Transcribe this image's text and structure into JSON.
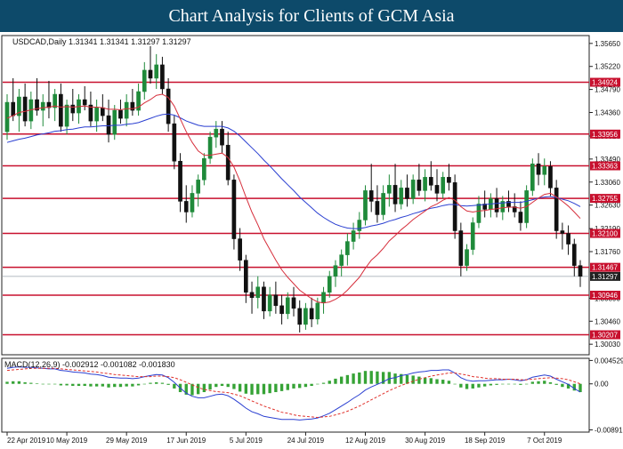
{
  "banner": {
    "title": "Chart Analysis for Clients of GCM Asia"
  },
  "colors": {
    "up": "#1f8a3a",
    "down": "#111111",
    "level_line": "#c8102e",
    "ma_red": "#d62f3c",
    "ma_blue": "#2a3fd1",
    "macd_line": "#2a3fd1",
    "signal_line": "#e0312b",
    "hist": "#36a336",
    "price_tag": "#222222"
  },
  "chart_data": [
    {
      "type": "candlestick",
      "symbol_label": "USDCAD,Daily  1.31341 1.31341 1.31297 1.31297",
      "ylim": [
        1.2985,
        1.3578
      ],
      "x_ticks": [
        "22 Apr 2019",
        "10 May 2019",
        "29 May 2019",
        "17 Jun 2019",
        "5 Jul 2019",
        "24 Jul 2019",
        "12 Aug 2019",
        "30 Aug 2019",
        "18 Sep 2019",
        "7 Oct 2019"
      ],
      "y_ticks": [
        1.3565,
        1.3522,
        1.3479,
        1.3436,
        1.3392,
        1.3349,
        1.3306,
        1.3263,
        1.3219,
        1.3176,
        1.3089,
        1.3046,
        1.3003
      ],
      "levels": [
        1.34924,
        1.33956,
        1.33363,
        1.32755,
        1.321,
        1.31467,
        1.30946,
        1.30207
      ],
      "level_labels": [
        "1.34924",
        "1.33956",
        "1.33363",
        "1.32755",
        "1.32100",
        "1.31467",
        "1.30946",
        "1.30207"
      ],
      "current_price": 1.31297,
      "current_price_label": "1.31297",
      "ohlc": [
        [
          1.34,
          1.347,
          1.3385,
          1.3455
        ],
        [
          1.3455,
          1.35,
          1.342,
          1.343
        ],
        [
          1.343,
          1.348,
          1.34,
          1.3465
        ],
        [
          1.3465,
          1.349,
          1.341,
          1.342
        ],
        [
          1.342,
          1.3475,
          1.3405,
          1.346
        ],
        [
          1.346,
          1.35,
          1.343,
          1.344
        ],
        [
          1.344,
          1.347,
          1.341,
          1.3455
        ],
        [
          1.3455,
          1.3495,
          1.3425,
          1.3445
        ],
        [
          1.3445,
          1.348,
          1.342,
          1.347
        ],
        [
          1.347,
          1.349,
          1.34,
          1.341
        ],
        [
          1.341,
          1.346,
          1.3395,
          1.345
        ],
        [
          1.345,
          1.348,
          1.342,
          1.3435
        ],
        [
          1.3435,
          1.347,
          1.3415,
          1.346
        ],
        [
          1.346,
          1.3485,
          1.344,
          1.345
        ],
        [
          1.345,
          1.3475,
          1.341,
          1.342
        ],
        [
          1.342,
          1.346,
          1.34,
          1.3445
        ],
        [
          1.3445,
          1.347,
          1.342,
          1.343
        ],
        [
          1.343,
          1.346,
          1.338,
          1.3395
        ],
        [
          1.3395,
          1.345,
          1.3385,
          1.344
        ],
        [
          1.344,
          1.346,
          1.3415,
          1.3425
        ],
        [
          1.3425,
          1.347,
          1.341,
          1.3455
        ],
        [
          1.3455,
          1.348,
          1.343,
          1.344
        ],
        [
          1.344,
          1.349,
          1.343,
          1.3475
        ],
        [
          1.3475,
          1.353,
          1.346,
          1.3515
        ],
        [
          1.3515,
          1.356,
          1.349,
          1.35
        ],
        [
          1.35,
          1.3545,
          1.348,
          1.3525
        ],
        [
          1.3525,
          1.354,
          1.347,
          1.348
        ],
        [
          1.348,
          1.35,
          1.34,
          1.3415
        ],
        [
          1.3415,
          1.343,
          1.333,
          1.3345
        ],
        [
          1.3345,
          1.336,
          1.325,
          1.327
        ],
        [
          1.327,
          1.33,
          1.323,
          1.325
        ],
        [
          1.325,
          1.33,
          1.324,
          1.3285
        ],
        [
          1.3285,
          1.332,
          1.326,
          1.331
        ],
        [
          1.331,
          1.336,
          1.33,
          1.335
        ],
        [
          1.335,
          1.34,
          1.334,
          1.339
        ],
        [
          1.339,
          1.342,
          1.337,
          1.3405
        ],
        [
          1.3405,
          1.342,
          1.336,
          1.3375
        ],
        [
          1.3375,
          1.34,
          1.33,
          1.331
        ],
        [
          1.331,
          1.332,
          1.318,
          1.32
        ],
        [
          1.32,
          1.322,
          1.314,
          1.316
        ],
        [
          1.316,
          1.317,
          1.308,
          1.31
        ],
        [
          1.31,
          1.312,
          1.306,
          1.309
        ],
        [
          1.309,
          1.313,
          1.307,
          1.311
        ],
        [
          1.311,
          1.312,
          1.305,
          1.3065
        ],
        [
          1.3065,
          1.311,
          1.3055,
          1.3095
        ],
        [
          1.3095,
          1.312,
          1.306,
          1.3075
        ],
        [
          1.3075,
          1.3095,
          1.304,
          1.306
        ],
        [
          1.306,
          1.31,
          1.305,
          1.309
        ],
        [
          1.309,
          1.311,
          1.3055,
          1.307
        ],
        [
          1.307,
          1.3085,
          1.3025,
          1.304
        ],
        [
          1.304,
          1.308,
          1.303,
          1.307
        ],
        [
          1.307,
          1.309,
          1.3035,
          1.305
        ],
        [
          1.305,
          1.309,
          1.304,
          1.308
        ],
        [
          1.308,
          1.311,
          1.306,
          1.31
        ],
        [
          1.31,
          1.314,
          1.309,
          1.313
        ],
        [
          1.313,
          1.316,
          1.311,
          1.315
        ],
        [
          1.315,
          1.318,
          1.313,
          1.317
        ],
        [
          1.317,
          1.321,
          1.315,
          1.3195
        ],
        [
          1.3195,
          1.323,
          1.318,
          1.3215
        ],
        [
          1.3215,
          1.325,
          1.32,
          1.3235
        ],
        [
          1.3235,
          1.33,
          1.3225,
          1.329
        ],
        [
          1.329,
          1.334,
          1.325,
          1.327
        ],
        [
          1.327,
          1.33,
          1.323,
          1.3245
        ],
        [
          1.3245,
          1.33,
          1.3235,
          1.3285
        ],
        [
          1.3285,
          1.332,
          1.326,
          1.33
        ],
        [
          1.33,
          1.334,
          1.325,
          1.3265
        ],
        [
          1.3265,
          1.331,
          1.3255,
          1.3295
        ],
        [
          1.3295,
          1.332,
          1.326,
          1.3275
        ],
        [
          1.3275,
          1.332,
          1.3265,
          1.331
        ],
        [
          1.331,
          1.334,
          1.328,
          1.329
        ],
        [
          1.329,
          1.333,
          1.327,
          1.3315
        ],
        [
          1.3315,
          1.3345,
          1.329,
          1.33
        ],
        [
          1.33,
          1.333,
          1.327,
          1.3285
        ],
        [
          1.3285,
          1.3325,
          1.3275,
          1.3315
        ],
        [
          1.3315,
          1.334,
          1.329,
          1.3305
        ],
        [
          1.3305,
          1.332,
          1.32,
          1.3215
        ],
        [
          1.3215,
          1.323,
          1.313,
          1.315
        ],
        [
          1.315,
          1.319,
          1.314,
          1.318
        ],
        [
          1.318,
          1.324,
          1.317,
          1.323
        ],
        [
          1.323,
          1.328,
          1.322,
          1.3265
        ],
        [
          1.3265,
          1.329,
          1.324,
          1.3255
        ],
        [
          1.3255,
          1.3285,
          1.324,
          1.3275
        ],
        [
          1.3275,
          1.3295,
          1.324,
          1.325
        ],
        [
          1.325,
          1.328,
          1.3235,
          1.327
        ],
        [
          1.327,
          1.329,
          1.325,
          1.326
        ],
        [
          1.326,
          1.3285,
          1.324,
          1.325
        ],
        [
          1.325,
          1.327,
          1.3215,
          1.323
        ],
        [
          1.323,
          1.33,
          1.322,
          1.329
        ],
        [
          1.329,
          1.335,
          1.328,
          1.334
        ],
        [
          1.334,
          1.336,
          1.33,
          1.332
        ],
        [
          1.332,
          1.335,
          1.33,
          1.3335
        ],
        [
          1.3335,
          1.3345,
          1.328,
          1.3295
        ],
        [
          1.3295,
          1.331,
          1.32,
          1.3215
        ],
        [
          1.3215,
          1.323,
          1.318,
          1.321
        ],
        [
          1.321,
          1.3225,
          1.317,
          1.319
        ],
        [
          1.319,
          1.32,
          1.313,
          1.315
        ],
        [
          1.315,
          1.316,
          1.311,
          1.313
        ]
      ],
      "ma_red": [
        1.3425,
        1.343,
        1.3436,
        1.3438,
        1.3441,
        1.3443,
        1.3445,
        1.3446,
        1.3448,
        1.3446,
        1.3447,
        1.3446,
        1.3447,
        1.3448,
        1.3446,
        1.3446,
        1.3445,
        1.3442,
        1.3442,
        1.3441,
        1.3443,
        1.3443,
        1.3446,
        1.3454,
        1.346,
        1.3468,
        1.347,
        1.3464,
        1.3448,
        1.3424,
        1.34,
        1.338,
        1.3364,
        1.3356,
        1.3356,
        1.3358,
        1.336,
        1.3352,
        1.3334,
        1.3308,
        1.3278,
        1.325,
        1.3226,
        1.32,
        1.318,
        1.316,
        1.3142,
        1.3128,
        1.3116,
        1.3104,
        1.3096,
        1.3088,
        1.3082,
        1.308,
        1.3082,
        1.3087,
        1.3094,
        1.3104,
        1.3116,
        1.3128,
        1.3145,
        1.316,
        1.317,
        1.3182,
        1.3196,
        1.3206,
        1.3217,
        1.3226,
        1.3236,
        1.3244,
        1.3252,
        1.326,
        1.3265,
        1.3272,
        1.3277,
        1.3272,
        1.326,
        1.3252,
        1.325,
        1.3252,
        1.3253,
        1.3255,
        1.3256,
        1.3258,
        1.3259,
        1.3259,
        1.3257,
        1.326,
        1.3268,
        1.3276,
        1.3283,
        1.3285,
        1.3278,
        1.327,
        1.3261,
        1.325,
        1.3238
      ],
      "ma_blue": [
        1.338,
        1.3383,
        1.3386,
        1.3388,
        1.3391,
        1.3394,
        1.3396,
        1.3398,
        1.3401,
        1.3402,
        1.3404,
        1.3405,
        1.3407,
        1.3409,
        1.3409,
        1.341,
        1.3411,
        1.3411,
        1.3412,
        1.3412,
        1.3414,
        1.3415,
        1.3417,
        1.3421,
        1.3425,
        1.3429,
        1.3432,
        1.3433,
        1.3431,
        1.3426,
        1.342,
        1.3416,
        1.3412,
        1.341,
        1.341,
        1.341,
        1.341,
        1.3407,
        1.3401,
        1.3392,
        1.3381,
        1.337,
        1.3359,
        1.3347,
        1.3336,
        1.3324,
        1.3312,
        1.3301,
        1.329,
        1.3278,
        1.3268,
        1.3258,
        1.3248,
        1.324,
        1.3233,
        1.3227,
        1.3223,
        1.322,
        1.3219,
        1.3219,
        1.3221,
        1.3224,
        1.3226,
        1.3229,
        1.3233,
        1.3236,
        1.324,
        1.3243,
        1.3247,
        1.325,
        1.3254,
        1.3257,
        1.3259,
        1.3262,
        1.3264,
        1.3264,
        1.3262,
        1.3261,
        1.3262,
        1.3263,
        1.3264,
        1.3265,
        1.3266,
        1.3267,
        1.3268,
        1.3268,
        1.3268,
        1.327,
        1.3273,
        1.3276,
        1.3278,
        1.3279,
        1.3277,
        1.3274,
        1.3271,
        1.3266,
        1.326
      ]
    },
    {
      "type": "macd",
      "label": "MACD(12,26,9) -0.002912 -0.001082 -0.001830",
      "ylim": [
        -0.009,
        0.0046
      ],
      "y_ticks": [
        0.004529,
        0.0,
        -0.008915
      ],
      "y_tick_labels": [
        "0.004529",
        "0.00",
        "-0.008915"
      ],
      "macd": [
        0.003,
        0.0032,
        0.0033,
        0.0032,
        0.0032,
        0.0031,
        0.003,
        0.0029,
        0.0029,
        0.0026,
        0.0025,
        0.0023,
        0.0022,
        0.0021,
        0.0019,
        0.0018,
        0.0016,
        0.0013,
        0.0012,
        0.0011,
        0.0011,
        0.001,
        0.0011,
        0.0014,
        0.0016,
        0.0018,
        0.0017,
        0.0012,
        0.0003,
        -0.0008,
        -0.0018,
        -0.0024,
        -0.0027,
        -0.0027,
        -0.0024,
        -0.0021,
        -0.002,
        -0.0023,
        -0.003,
        -0.0038,
        -0.0047,
        -0.0054,
        -0.0058,
        -0.0063,
        -0.0065,
        -0.0067,
        -0.0069,
        -0.0069,
        -0.0069,
        -0.007,
        -0.0069,
        -0.0068,
        -0.0066,
        -0.0062,
        -0.0057,
        -0.005,
        -0.0043,
        -0.0036,
        -0.0028,
        -0.0021,
        -0.0012,
        -0.0006,
        -0.0001,
        0.0004,
        0.001,
        0.0012,
        0.0016,
        0.0018,
        0.0021,
        0.0023,
        0.0024,
        0.0026,
        0.0026,
        0.0027,
        0.0027,
        0.0021,
        0.0012,
        0.0007,
        0.0005,
        0.0006,
        0.0006,
        0.0007,
        0.0008,
        0.0008,
        0.0009,
        0.0008,
        0.0006,
        0.0008,
        0.0013,
        0.0015,
        0.0017,
        0.0015,
        0.0009,
        0.0004,
        -0.0001,
        -0.0009,
        -0.0016
      ],
      "signal": [
        0.0026,
        0.0027,
        0.0028,
        0.0029,
        0.003,
        0.003,
        0.003,
        0.003,
        0.003,
        0.0029,
        0.0028,
        0.0027,
        0.0026,
        0.0025,
        0.0024,
        0.0023,
        0.0021,
        0.002,
        0.0018,
        0.0017,
        0.0016,
        0.0015,
        0.0014,
        0.0014,
        0.0014,
        0.0015,
        0.0015,
        0.0014,
        0.0012,
        0.0008,
        0.0003,
        -0.0002,
        -0.0007,
        -0.0011,
        -0.0013,
        -0.0015,
        -0.0016,
        -0.0017,
        -0.002,
        -0.0023,
        -0.0028,
        -0.0033,
        -0.0038,
        -0.0043,
        -0.0047,
        -0.0051,
        -0.0055,
        -0.0057,
        -0.006,
        -0.0062,
        -0.0063,
        -0.0064,
        -0.0065,
        -0.0064,
        -0.0063,
        -0.006,
        -0.0057,
        -0.0053,
        -0.0048,
        -0.0043,
        -0.0037,
        -0.0031,
        -0.0025,
        -0.0019,
        -0.0013,
        -0.0008,
        -0.0003,
        0.0001,
        0.0005,
        0.0009,
        0.0012,
        0.0015,
        0.0017,
        0.0019,
        0.0021,
        0.0021,
        0.0019,
        0.0017,
        0.0014,
        0.0013,
        0.0011,
        0.001,
        0.001,
        0.0009,
        0.0009,
        0.0009,
        0.0008,
        0.0008,
        0.0009,
        0.001,
        0.0011,
        0.0012,
        0.0011,
        0.001,
        0.0008,
        0.0004,
        0.0
      ]
    }
  ]
}
